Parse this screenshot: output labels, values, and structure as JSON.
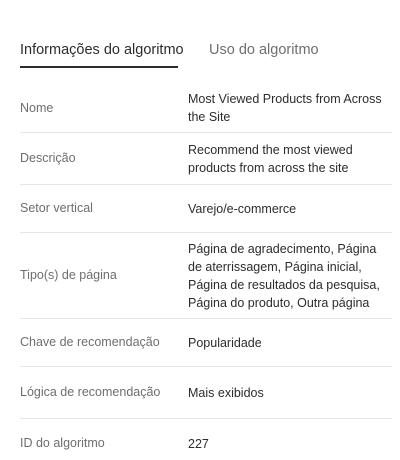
{
  "tabs": [
    {
      "label": "Informações do algoritmo",
      "active": true
    },
    {
      "label": "Uso do algoritmo",
      "active": false
    }
  ],
  "info": {
    "rows": [
      {
        "label": "Nome",
        "value": "Most Viewed Products from Across the Site"
      },
      {
        "label": "Descrição",
        "value": "Recommend the most viewed products from across the site"
      },
      {
        "label": "Setor vertical",
        "value": "Varejo/e-commerce"
      },
      {
        "label": "Tipo(s) de página",
        "value": "Página de agradecimento, Página de aterrissagem, Página inicial, Página de resultados da pesquisa, Página do produto, Outra página"
      },
      {
        "label": "Chave de recomendação",
        "value": "Popularidade"
      },
      {
        "label": "Lógica de recomendação",
        "value": "Mais exibidos"
      },
      {
        "label": "ID do algoritmo",
        "value": "227"
      }
    ]
  },
  "colors": {
    "text_primary": "#2c2c2c",
    "text_secondary": "#6e6e6e",
    "divider": "#e6e6e6",
    "tab_indicator": "#2c2c2c"
  }
}
